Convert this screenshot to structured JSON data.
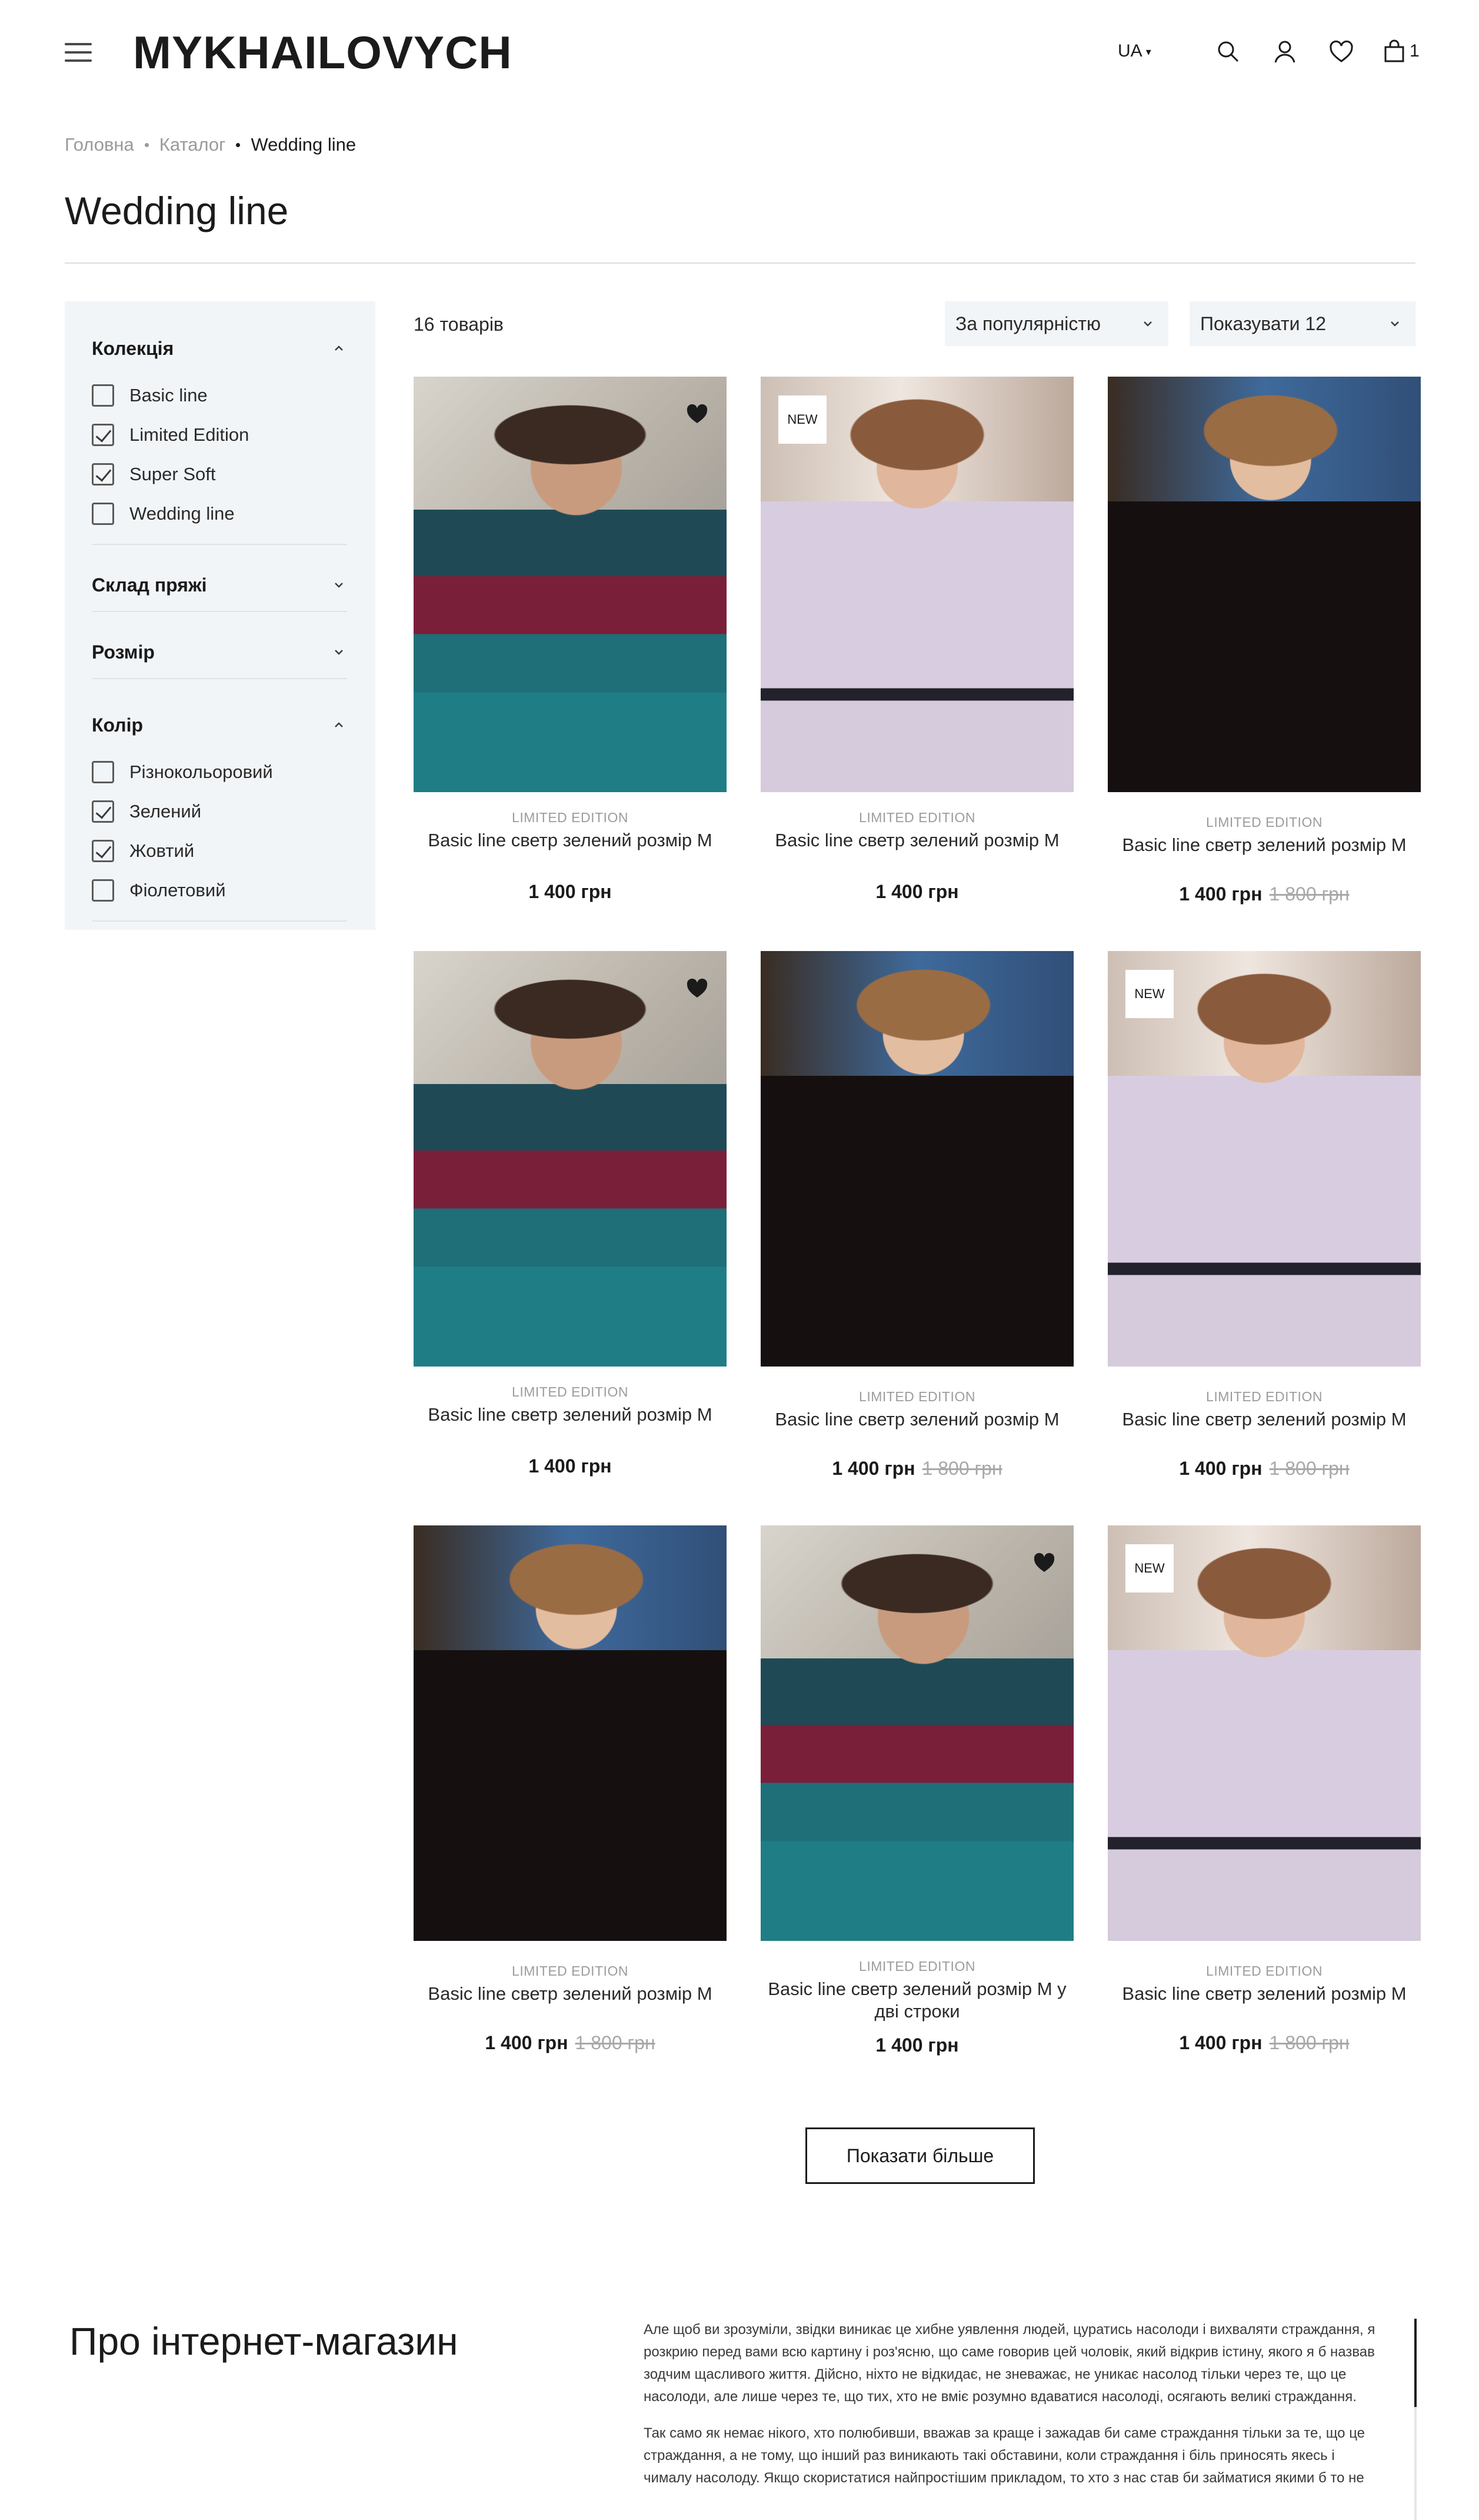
{
  "header": {
    "logo": "MYKHAILOVYCH",
    "lang": "UA",
    "cart_count": "1"
  },
  "breadcrumb": {
    "home": "Головна",
    "catalog": "Каталог",
    "current": "Wedding line"
  },
  "page_title": "Wedding line",
  "filters": {
    "collection": {
      "title": "Колекція",
      "items": [
        {
          "label": "Basic line",
          "checked": false
        },
        {
          "label": "Limited Edition",
          "checked": true
        },
        {
          "label": "Super Soft",
          "checked": true
        },
        {
          "label": "Wedding line",
          "checked": false
        }
      ]
    },
    "composition": {
      "title": "Склад пряжі"
    },
    "size": {
      "title": "Розмір"
    },
    "color": {
      "title": "Колір",
      "items": [
        {
          "label": "Різнокольоровий",
          "checked": false
        },
        {
          "label": "Зелений",
          "checked": true
        },
        {
          "label": "Жовтий",
          "checked": true
        },
        {
          "label": "Фіолетовий",
          "checked": false
        }
      ]
    }
  },
  "toolbar": {
    "count": "16 товарів",
    "sort": "За популярністю",
    "per_page": "Показувати 12"
  },
  "products": [
    {
      "collection": "LIMITED EDITION",
      "name": "Basic line светр зелений розмір M",
      "price": "1 400 грн",
      "old_price": "",
      "badge": "",
      "fav": true
    },
    {
      "collection": "LIMITED EDITION",
      "name": "Basic line светр зелений розмір M",
      "price": "1 400 грн",
      "old_price": "",
      "badge": "NEW",
      "fav": false
    },
    {
      "collection": "LIMITED EDITION",
      "name": "Basic line светр зелений розмір M",
      "price": "1 400 грн",
      "old_price": "1 800 грн",
      "badge": "",
      "fav": false
    },
    {
      "collection": "LIMITED EDITION",
      "name": "Basic line светр зелений розмір M",
      "price": "1 400 грн",
      "old_price": "",
      "badge": "",
      "fav": true
    },
    {
      "collection": "LIMITED EDITION",
      "name": "Basic line светр зелений розмір M",
      "price": "1 400 грн",
      "old_price": "1 800 грн",
      "badge": "",
      "fav": false
    },
    {
      "collection": "LIMITED EDITION",
      "name": "Basic line светр зелений розмір M",
      "price": "1 400 грн",
      "old_price": "1 800 грн",
      "badge": "NEW",
      "fav": false
    },
    {
      "collection": "LIMITED EDITION",
      "name": "Basic line светр зелений розмір M",
      "price": "1 400 грн",
      "old_price": "1 800 грн",
      "badge": "",
      "fav": false
    },
    {
      "collection": "LIMITED EDITION",
      "name": "Basic line светр зелений розмір M у дві строки",
      "price": "1 400 грн",
      "old_price": "",
      "badge": "",
      "fav": true
    },
    {
      "collection": "LIMITED EDITION",
      "name": "Basic line светр зелений розмір M",
      "price": "1 400 грн",
      "old_price": "1 800 грн",
      "badge": "NEW",
      "fav": false
    }
  ],
  "load_more": "Показати більше",
  "about": {
    "title": "Про інтернет-магазин",
    "p1": "Але щоб ви зрозуміли, звідки виникає це хибне уявлення людей, цуратись насолоди і вихваляти страждання, я розкрию перед вами всю картину і роз'ясню, що саме говорив цей чоловік, який відкрив істину, якого я б назвав зодчим щасливого життя. Дійсно, ніхто не відкидає, не зневажає, не уникає насолод тільки через те, що це насолоди, але лише через те, що тих, хто не вміє розумно вдаватися насолоді, осягають великі страждання.",
    "p2": "Так само як немає нікого, хто полюбивши, вважав за краще і зажадав би саме страждання тільки за те, що це страждання, а не тому, що інший раз виникають такі обставини, коли страждання і біль приносять якесь і чималу насолоду. Якщо скористатися найпростішим прикладом, то хто з нас став би займатися якими б то не"
  }
}
